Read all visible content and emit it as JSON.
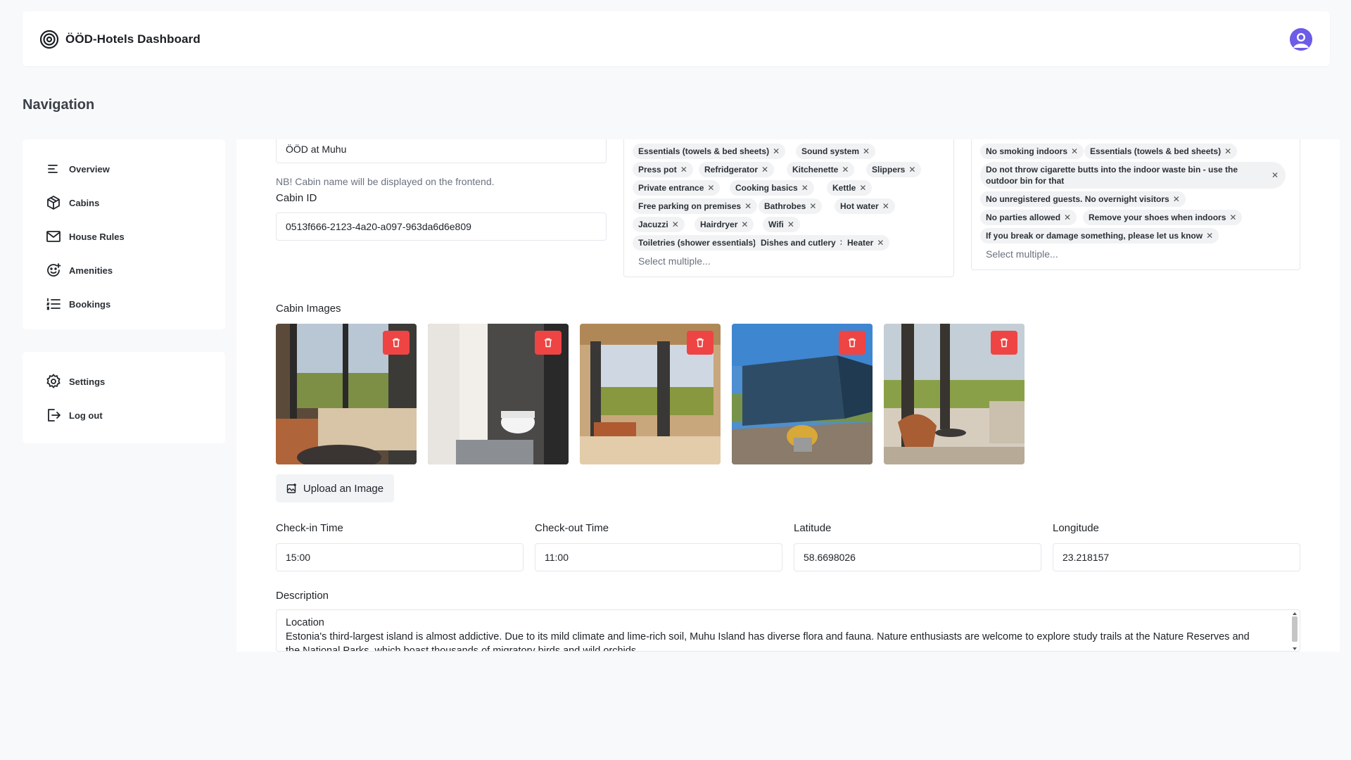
{
  "header": {
    "title": "ÖÖD-Hotels Dashboard"
  },
  "sidebar": {
    "heading": "Navigation",
    "items": [
      {
        "label": "Overview",
        "icon": "list-icon"
      },
      {
        "label": "Cabins",
        "icon": "cube-icon"
      },
      {
        "label": "House Rules",
        "icon": "mail-icon"
      },
      {
        "label": "Amenities",
        "icon": "smile-icon"
      },
      {
        "label": "Bookings",
        "icon": "list-ordered-icon"
      }
    ],
    "bottom_items": [
      {
        "label": "Settings",
        "icon": "gear-icon"
      },
      {
        "label": "Log out",
        "icon": "logout-icon"
      }
    ]
  },
  "form": {
    "cabin_name": {
      "value": "ÖÖD at Muhu",
      "helper": "NB! Cabin name will be displayed on the frontend."
    },
    "cabin_id": {
      "label": "Cabin ID",
      "value": "0513f666-2123-4a20-a097-963da6d6e809"
    },
    "amenities": {
      "chips": [
        "Essentials (towels & bed sheets)",
        "Sound system",
        "Press pot",
        "Refridgerator",
        "Kitchenette",
        "Slippers",
        "Private entrance",
        "Cooking basics",
        "Kettle",
        "Free parking on premises",
        "Bathrobes",
        "Hot water",
        "Jacuzzi",
        "Hairdryer",
        "Wifi",
        "Toiletries (shower essentials)",
        "Dishes and cutlery",
        "Heater"
      ],
      "placeholder": "Select multiple..."
    },
    "house_rules": {
      "chips": [
        "No smoking indoors",
        "Essentials (towels & bed sheets)",
        "Do not throw cigarette butts into the indoor waste bin - use the outdoor bin for that",
        "No unregistered guests. No overnight visitors",
        "No parties allowed",
        "Remove your shoes when indoors",
        "If you break or damage something, please let us know"
      ],
      "placeholder": "Select multiple..."
    },
    "images": {
      "label": "Cabin Images",
      "upload_label": "Upload an Image"
    },
    "checkin": {
      "label": "Check-in Time",
      "value": "15:00"
    },
    "checkout": {
      "label": "Check-out Time",
      "value": "11:00"
    },
    "latitude": {
      "label": "Latitude",
      "value": "58.6698026"
    },
    "longitude": {
      "label": "Longitude",
      "value": "23.218157"
    },
    "description": {
      "label": "Description",
      "line1": "Location",
      "line2": "Estonia's third-largest island is almost addictive. Due to its mild climate and lime-rich soil, Muhu Island has diverse flora and fauna. Nature enthusiasts are welcome to explore study trails at the Nature Reserves and",
      "line3": "the National Parks, which boast thousands of migratory birds and wild orchids."
    }
  },
  "colors": {
    "accent": "#6c5ce7",
    "delete": "#ef4444"
  }
}
